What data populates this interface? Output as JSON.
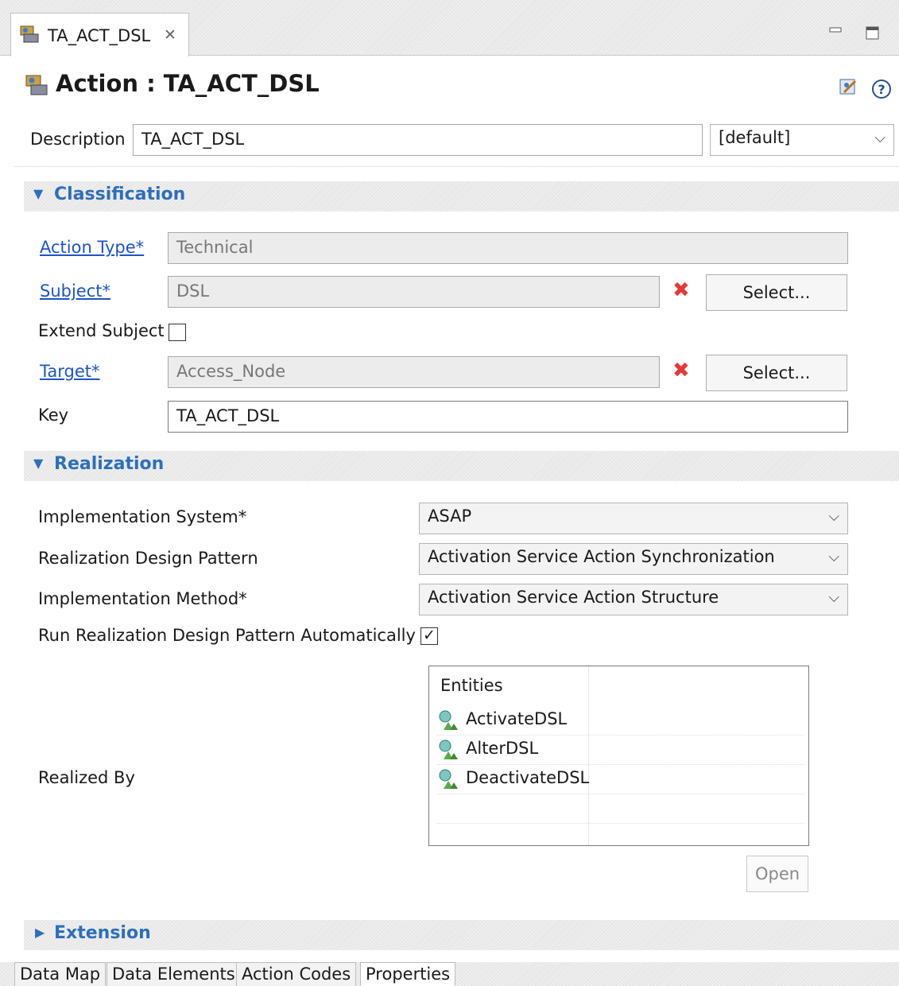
{
  "editor_tab": {
    "title": "TA_ACT_DSL",
    "close_glyph": "✕"
  },
  "window_controls": {
    "minimize": "▭",
    "maximize": "□"
  },
  "header": {
    "title": "Action : TA_ACT_DSL",
    "icons": [
      "tools-icon",
      "help-icon"
    ]
  },
  "description": {
    "label": "Description",
    "value": "TA_ACT_DSL",
    "language": "[default]"
  },
  "classification": {
    "title": "Classification",
    "action_type_label": "Action Type*",
    "action_type_value": "Technical",
    "subject_label": "Subject*",
    "subject_value": "DSL",
    "extend_subject_label": "Extend Subject",
    "extend_subject_checked": false,
    "target_label": "Target*",
    "target_value": "Access_Node",
    "key_label": "Key",
    "key_value": "TA_ACT_DSL",
    "select_label": "Select..."
  },
  "realization": {
    "title": "Realization",
    "impl_system_label": "Implementation System*",
    "impl_system_value": "ASAP",
    "design_pattern_label": "Realization Design Pattern",
    "design_pattern_value": "Activation Service Action Synchronization",
    "impl_method_label": "Implementation Method*",
    "impl_method_value": "Activation Service Action Structure",
    "run_auto_label": "Run Realization Design Pattern Automatically",
    "run_auto_checked": true,
    "realized_by_label": "Realized By",
    "entities_header": "Entities",
    "entities": [
      "ActivateDSL",
      "AlterDSL",
      "DeactivateDSL"
    ],
    "open_label": "Open"
  },
  "extension": {
    "title": "Extension"
  },
  "bottom_tabs": [
    "Data Map",
    "Data Elements",
    "Action Codes",
    "Properties"
  ],
  "active_bottom_tab": "Properties",
  "colors": {
    "link": "#1d55c2",
    "section_title": "#2f6fb8",
    "remove_icon": "#e23a3a"
  }
}
